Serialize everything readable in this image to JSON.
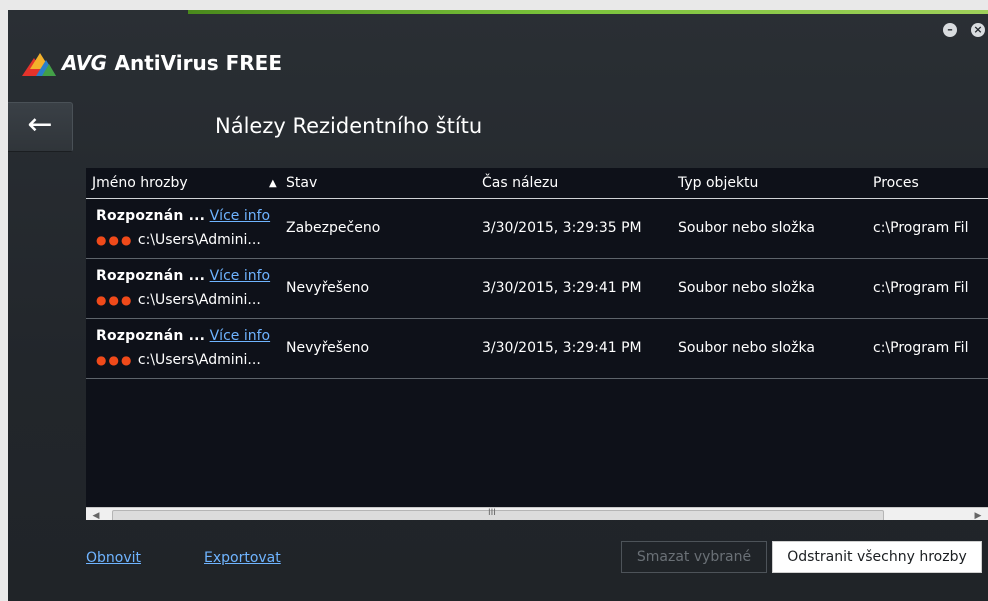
{
  "app": {
    "brand": "AVG",
    "product": "AntiVirus FREE",
    "minimize_icon": "minus-icon",
    "close_icon": "close-icon"
  },
  "nav": {
    "back_icon": "arrow-left-icon"
  },
  "page": {
    "title": "Nálezy Rezidentního štítu"
  },
  "table": {
    "columns": [
      "Jméno hrozby",
      "Stav",
      "Čas nálezu",
      "Typ objektu",
      "Proces"
    ],
    "sort_indicator": "▲",
    "rows": [
      {
        "name": "Rozpoznán ...",
        "more": "Více info",
        "path": "c:\\Users\\Admini...",
        "status": "Zabezpečeno",
        "time": "3/30/2015, 3:29:35 PM",
        "type": "Soubor nebo složka",
        "process": "c:\\Program Fil"
      },
      {
        "name": "Rozpoznán ...",
        "more": "Více info",
        "path": "c:\\Users\\Admini...",
        "status": "Nevyřešeno",
        "time": "3/30/2015, 3:29:41 PM",
        "type": "Soubor nebo složka",
        "process": "c:\\Program Fil"
      },
      {
        "name": "Rozpoznán ...",
        "more": "Více info",
        "path": "c:\\Users\\Admini...",
        "status": "Nevyřešeno",
        "time": "3/30/2015, 3:29:41 PM",
        "type": "Soubor nebo složka",
        "process": "c:\\Program Fil"
      }
    ],
    "severity_dots": "●●●"
  },
  "footer": {
    "refresh": "Obnovit",
    "export": "Exportovat",
    "delete_selected": "Smazat vybrané",
    "remove_all": "Odstranit všechny hrozby"
  },
  "colors": {
    "link": "#6fb4ff",
    "accent": "#79c23a",
    "severity": "#f04a1a"
  }
}
